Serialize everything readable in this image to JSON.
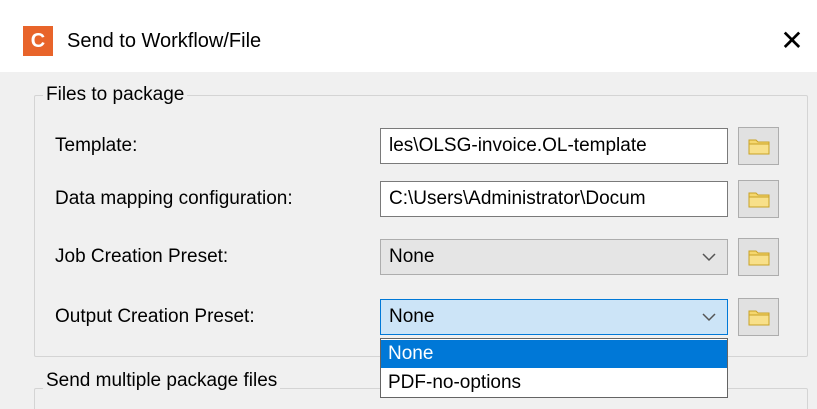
{
  "window": {
    "app_icon_letter": "C",
    "title": "Send to Workflow/File",
    "close_glyph": "✕"
  },
  "files_group": {
    "legend": "Files to package",
    "template": {
      "label": "Template:",
      "value": "les\\OLSG-invoice.OL-template"
    },
    "data_mapping": {
      "label": "Data mapping configuration:",
      "value": "C:\\Users\\Administrator\\Docum"
    },
    "job_preset": {
      "label": "Job Creation Preset:",
      "value": "None"
    },
    "output_preset": {
      "label": "Output Creation Preset:",
      "value": "None"
    }
  },
  "output_preset_dropdown": {
    "options": [
      "None",
      "PDF-no-options"
    ],
    "selected": "None"
  },
  "multi_group": {
    "legend": "Send multiple package files"
  },
  "icons": {
    "browse": "folder-icon",
    "select_arrow": "chevron-down-icon",
    "close": "close-icon"
  },
  "colors": {
    "brand": "#e8642a",
    "selection": "#0078d7",
    "focus_fill": "#cce4f7"
  }
}
